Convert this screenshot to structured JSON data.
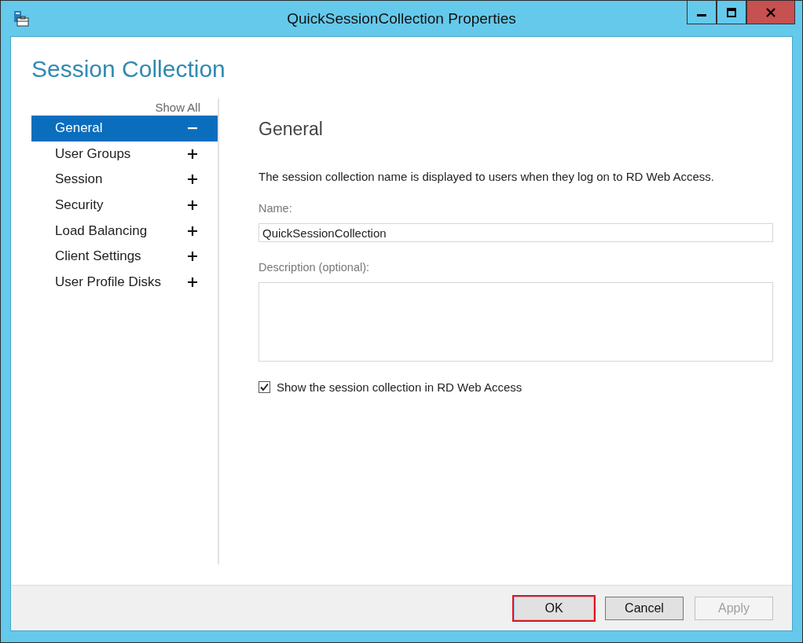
{
  "window": {
    "title": "QuickSessionCollection Properties"
  },
  "page_title": "Session Collection",
  "sidebar": {
    "show_all": "Show All",
    "items": [
      {
        "label": "General",
        "selected": true,
        "expanded": true
      },
      {
        "label": "User Groups",
        "selected": false,
        "expanded": false
      },
      {
        "label": "Session",
        "selected": false,
        "expanded": false
      },
      {
        "label": "Security",
        "selected": false,
        "expanded": false
      },
      {
        "label": "Load Balancing",
        "selected": false,
        "expanded": false
      },
      {
        "label": "Client Settings",
        "selected": false,
        "expanded": false
      },
      {
        "label": "User Profile Disks",
        "selected": false,
        "expanded": false
      }
    ]
  },
  "general": {
    "heading": "General",
    "description": "The session collection name is displayed to users when they log on to RD Web Access.",
    "name_label": "Name:",
    "name_value": "QuickSessionCollection",
    "description_label": "Description (optional):",
    "show_in_web_access": {
      "label": "Show the session collection in RD Web Access",
      "checked": true
    }
  },
  "buttons": [
    {
      "label": "OK",
      "disabled": false,
      "highlighted": true
    },
    {
      "label": "Cancel",
      "disabled": false,
      "highlighted": false
    },
    {
      "label": "Apply",
      "disabled": true,
      "highlighted": false
    }
  ]
}
